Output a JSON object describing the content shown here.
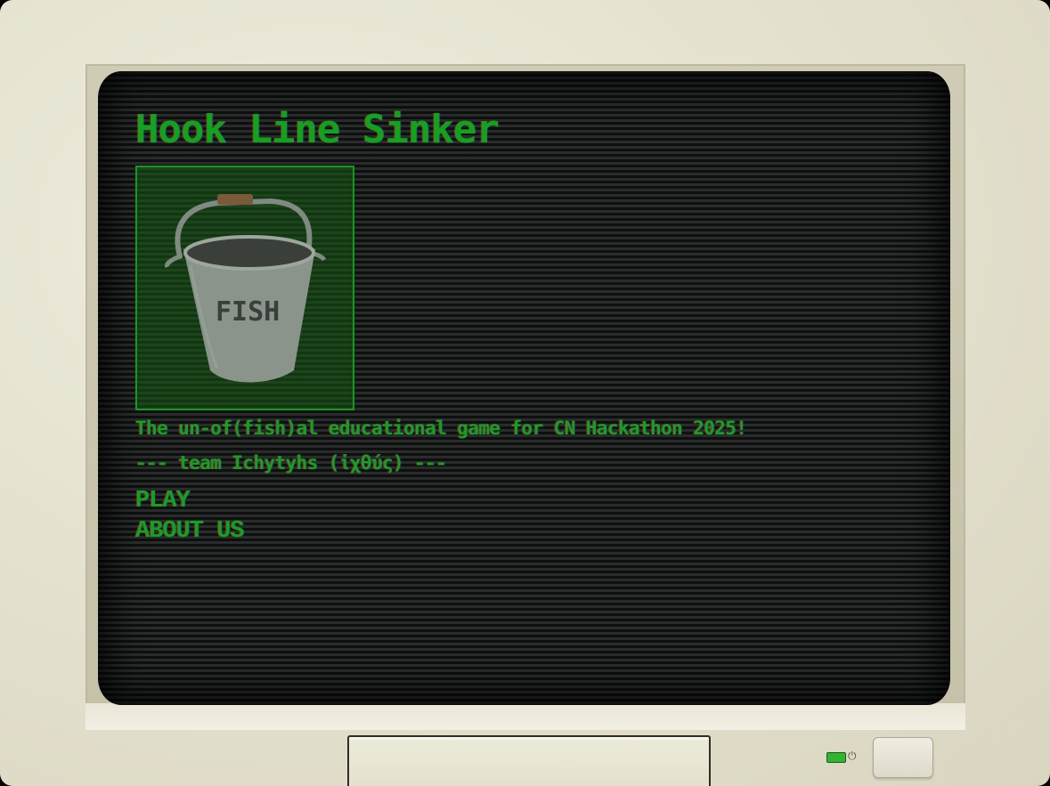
{
  "game": {
    "title": "Hook Line Sinker",
    "tagline": "The un-of(fish)al educational game for CN Hackathon 2025!",
    "team_line": "--- team Ichytyhs (ἰχθύς) ---",
    "logo": {
      "icon": "fish-bucket-icon",
      "bucket_label": "FISH"
    }
  },
  "menu": {
    "items": [
      {
        "label": "PLAY",
        "name": "play-button"
      },
      {
        "label": "ABOUT US",
        "name": "about-us-button"
      }
    ]
  },
  "hardware": {
    "power_led_color": "#2fb52f",
    "power_symbol": "⏻"
  },
  "colors": {
    "phosphor_green": "#12a31c",
    "screen_bg": "#1b1c1c",
    "bezel": "#e4e1cf"
  }
}
